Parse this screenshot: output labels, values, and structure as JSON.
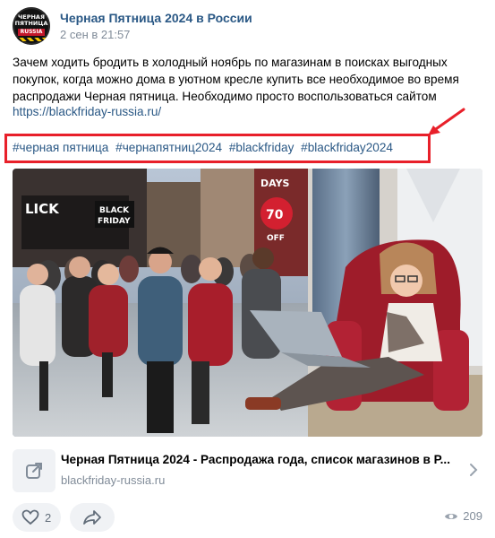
{
  "group": {
    "name": "Черная Пятница 2024 в России",
    "date": "2 сен в 21:57",
    "avatar_line1": "ЧЕРНАЯ ПЯТНИЦА",
    "avatar_line2": "RUSSIA"
  },
  "post": {
    "text": "Зачем ходить бродить в холодный ноябрь по магазинам в поисках выгодных покупок, когда можно дома в уютном кресле купить все необходимое во время распродажи Черная пятница. Необходимо просто воспользоваться сайтом",
    "link": "https://blackfriday-russia.ru/",
    "hashtags": [
      "#черная пятница",
      "#чернапятниц2024",
      "#blackfriday",
      "#blackfriday2024"
    ]
  },
  "image": {
    "sign_left": "LICK",
    "sign_black": "BLACK",
    "sign_friday": "FRIDAY",
    "sign_days": "DAYS",
    "sign_percent": "70",
    "sign_off": "OFF"
  },
  "card": {
    "title": "Черная Пятница 2024 - Распродажа года, список магазинов в Р...",
    "domain": "blackfriday-russia.ru"
  },
  "footer": {
    "likes": "2",
    "views": "209"
  },
  "colors": {
    "link": "#2a5885",
    "secondary": "#818c99",
    "highlight_box": "#e8202a",
    "button_bg": "#f0f2f5"
  },
  "icons": [
    "heart-icon",
    "share-icon",
    "eye-icon",
    "external-link-icon",
    "chevron-right-icon"
  ]
}
